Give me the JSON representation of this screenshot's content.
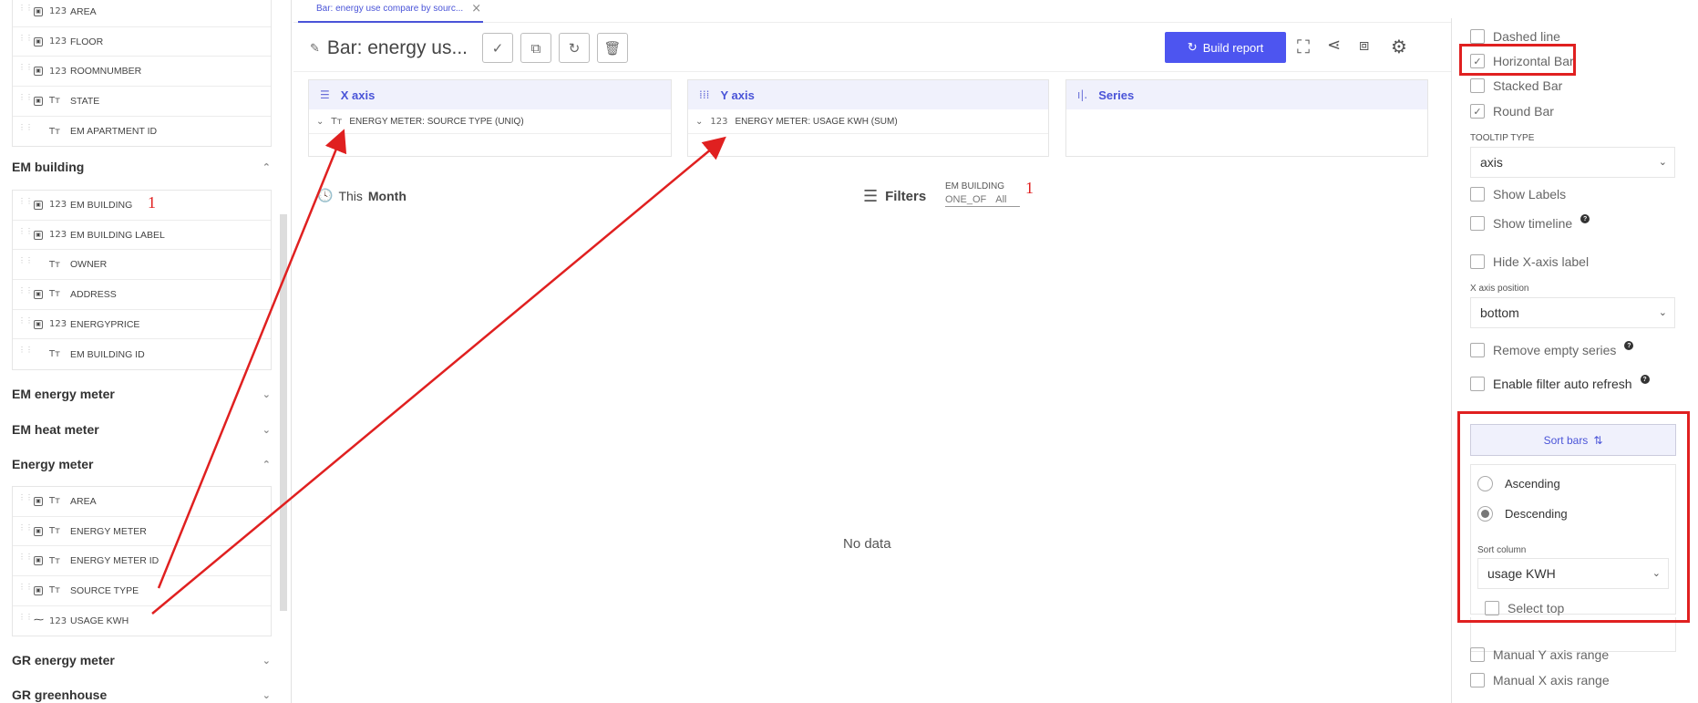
{
  "sidebar": {
    "group_top": [
      {
        "icon_a": "▣",
        "type": "123",
        "name": "AREA"
      },
      {
        "icon_a": "▣",
        "type": "123",
        "name": "FLOOR"
      },
      {
        "icon_a": "▣",
        "type": "123",
        "name": "ROOMNUMBER"
      },
      {
        "icon_a": "▣",
        "type": "Tт",
        "name": "STATE"
      },
      {
        "icon_a": "",
        "type": "Tт",
        "name": "EM APARTMENT ID"
      }
    ],
    "sections": {
      "em_building": "EM building",
      "em_energy_meter": "EM energy meter",
      "em_heat_meter": "EM heat meter",
      "energy_meter": "Energy meter",
      "gr_energy_meter": "GR energy meter",
      "gr_greenhouse": "GR greenhouse"
    },
    "group_building": [
      {
        "icon_a": "▣",
        "type": "123",
        "name": "EM BUILDING"
      },
      {
        "icon_a": "▣",
        "type": "123",
        "name": "EM BUILDING LABEL"
      },
      {
        "icon_a": "",
        "type": "Tт",
        "name": "OWNER"
      },
      {
        "icon_a": "▣",
        "type": "Tт",
        "name": "ADDRESS"
      },
      {
        "icon_a": "▣",
        "type": "123",
        "name": "ENERGYPRICE"
      },
      {
        "icon_a": "",
        "type": "Tт",
        "name": "EM BUILDING ID"
      }
    ],
    "group_energy": [
      {
        "icon_a": "▣",
        "type": "Tт",
        "name": "AREA"
      },
      {
        "icon_a": "▣",
        "type": "Tт",
        "name": "ENERGY METER"
      },
      {
        "icon_a": "▣",
        "type": "Tт",
        "name": "ENERGY METER ID"
      },
      {
        "icon_a": "▣",
        "type": "Tт",
        "name": "SOURCE TYPE"
      },
      {
        "icon_a": "⁓",
        "type": "123",
        "name": "USAGE KWH"
      }
    ]
  },
  "tab": {
    "label": "Bar: energy use compare by sourc..."
  },
  "toolbar": {
    "title": "Bar: energy us...",
    "build_label": "Build report"
  },
  "axes": {
    "x": {
      "label": "X axis",
      "icon": "☰",
      "field_type": "Tт",
      "field": "ENERGY METER: SOURCE TYPE (UNIQ)"
    },
    "y": {
      "label": "Y axis",
      "icon": "⁞⁞⁞",
      "field_type": "123",
      "field": "ENERGY METER: USAGE KWH (SUM)"
    },
    "series": {
      "label": "Series",
      "icon": "ı|."
    }
  },
  "period": {
    "prefix": "This",
    "value": "Month"
  },
  "filters": {
    "label": "Filters",
    "chip_title": "EM BUILDING",
    "chip_op": "ONE_OF",
    "chip_val": "All"
  },
  "annotations": {
    "mark1": "1",
    "mark2": "1"
  },
  "nodata": "No data",
  "options": {
    "dashed_line": {
      "label": "Dashed line",
      "checked": false
    },
    "horizontal_bar": {
      "label": "Horizontal Bar",
      "checked": true
    },
    "stacked_bar": {
      "label": "Stacked Bar",
      "checked": false
    },
    "round_bar": {
      "label": "Round Bar",
      "checked": true
    },
    "tooltip_type_label": "TOOLTIP TYPE",
    "tooltip_type": "axis",
    "show_labels": {
      "label": "Show Labels",
      "checked": false
    },
    "show_timeline": {
      "label": "Show timeline",
      "checked": false
    },
    "hide_x_label": {
      "label": "Hide X-axis label",
      "checked": false
    },
    "x_pos_label": "X axis position",
    "x_pos": "bottom",
    "remove_empty": {
      "label": "Remove empty series",
      "checked": false
    },
    "auto_refresh": {
      "label": "Enable filter auto refresh",
      "checked": false
    },
    "sort_bars": "Sort bars",
    "ascending": "Ascending",
    "descending": "Descending",
    "sort_column_label": "Sort column",
    "sort_column": "usage KWH",
    "select_top": {
      "label": "Select top",
      "checked": false
    },
    "manual_y": {
      "label": "Manual Y axis range",
      "checked": false
    },
    "manual_x": {
      "label": "Manual X axis range",
      "checked": false
    }
  },
  "colors": {
    "accent": "#4d55f0",
    "annotation": "#e02020"
  }
}
